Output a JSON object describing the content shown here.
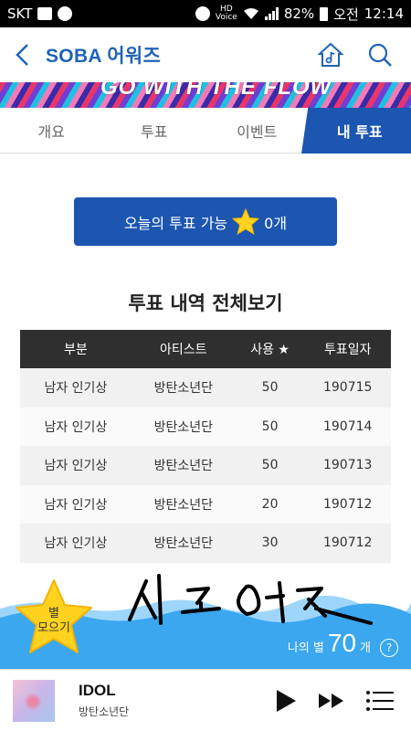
{
  "status_bar": {
    "carrier": "SKT",
    "battery": "82%",
    "time_label": "오전",
    "time": "12:14"
  },
  "header": {
    "title": "SOBA 어워즈"
  },
  "banner": {
    "text": "GO WITH THE FLOW"
  },
  "tabs": [
    {
      "label": "개요",
      "active": false
    },
    {
      "label": "투표",
      "active": false
    },
    {
      "label": "이벤트",
      "active": false
    },
    {
      "label": "내 투표",
      "active": true
    }
  ],
  "vote_button": {
    "label_prefix": "오늘의 투표 가능",
    "count": "0개"
  },
  "history": {
    "title": "투표 내역 전체보기",
    "columns": [
      "부분",
      "아티스트",
      "사용 ★",
      "투표일자"
    ],
    "rows": [
      [
        "남자 인기상",
        "방탄소년단",
        "50",
        "190715"
      ],
      [
        "남자 인기상",
        "방탄소년단",
        "50",
        "190714"
      ],
      [
        "남자 인기상",
        "방탄소년단",
        "50",
        "190713"
      ],
      [
        "남자 인기상",
        "방탄소년단",
        "20",
        "190712"
      ],
      [
        "남자 인기상",
        "방탄소년단",
        "30",
        "190712"
      ]
    ]
  },
  "star_collect": {
    "line1": "별",
    "line2": "모으기"
  },
  "my_stars": {
    "label": "나의 별",
    "count": "70",
    "unit": "개",
    "help": "?"
  },
  "player": {
    "title": "IDOL",
    "artist": "방탄소년단"
  },
  "colors": {
    "brand_blue": "#1c56b0",
    "title_blue": "#1f63b6",
    "table_header": "#2f2f2f",
    "wave_blue": "#3aa7ef",
    "star_yellow": "#ffd21f"
  }
}
